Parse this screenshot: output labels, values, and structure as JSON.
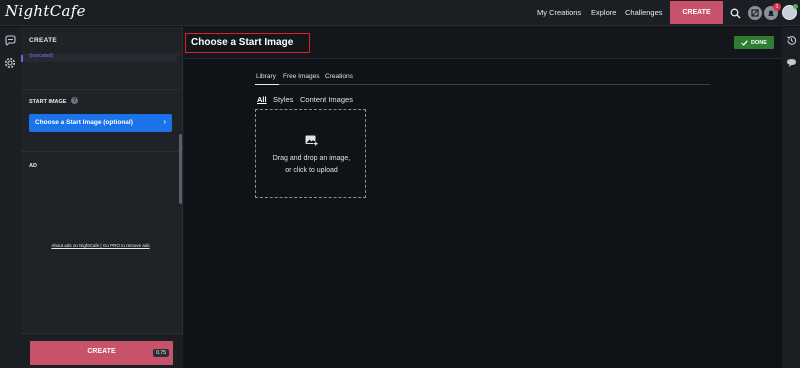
{
  "app": {
    "logo_text": "NightCafe"
  },
  "topnav": {
    "links": [
      "My Creations",
      "Explore",
      "Challenges"
    ],
    "create_label": "CREATE",
    "notification_count": "1"
  },
  "sidebar": {
    "title": "CREATE",
    "purple_text": "(truncated)",
    "start_image": {
      "label": "START IMAGE",
      "help": "?",
      "button_label": "Choose a Start Image (optional)",
      "button_chevron": "›"
    },
    "ad": {
      "label": "AD",
      "link_text": "About ads on NightCafe | Go PRO to remove ads"
    },
    "create_button": {
      "label": "CREATE",
      "cost": "0.75"
    }
  },
  "main": {
    "title": "Choose a Start Image",
    "done_label": "DONE",
    "tabs": [
      "Library",
      "Free Images",
      "Creations"
    ],
    "subtabs": [
      "All",
      "Styles",
      "Content Images"
    ],
    "dropzone": {
      "line1": "Drag and drop an image,",
      "line2": "or click to upload"
    }
  },
  "colors": {
    "accent": "#c9526b",
    "blue": "#1a73e8",
    "done_green": "#2e7d32",
    "title_border": "#e0202b"
  }
}
